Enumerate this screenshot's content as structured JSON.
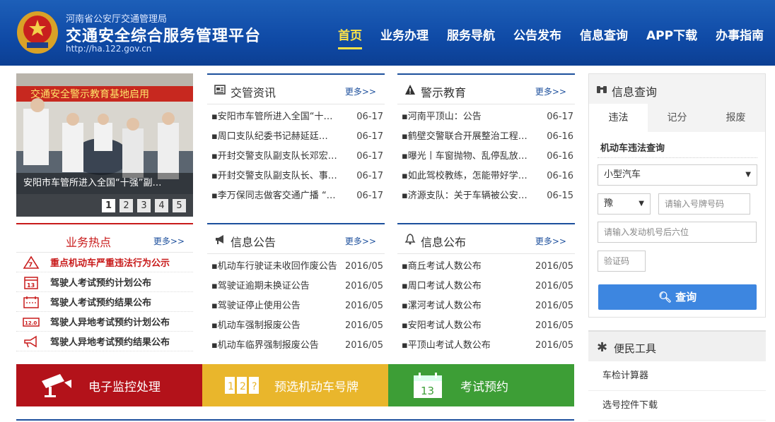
{
  "header": {
    "org": "河南省公安厅交通管理局",
    "title": "交通安全综合服务管理平台",
    "url": "http://ha.122.gov.cn",
    "nav": [
      "首页",
      "业务办理",
      "服务导航",
      "公告发布",
      "信息查询",
      "APP下载",
      "办事指南"
    ]
  },
  "slider": {
    "banner_text": "交通安全警示教育基地启用",
    "caption": "安阳市车管所进入全国“十强”副…",
    "pages": [
      "1",
      "2",
      "3",
      "4",
      "5"
    ],
    "active_page": "1"
  },
  "news": {
    "title": "交管资讯",
    "more": "更多>>",
    "items": [
      {
        "t": "▪安阳市车管所进入全国“十…",
        "d": "06-17"
      },
      {
        "t": "▪周口支队纪委书记赫延廷…",
        "d": "06-17"
      },
      {
        "t": "▪开封交警支队副支队长邓宏…",
        "d": "06-17"
      },
      {
        "t": "▪开封交警支队副支队长、事…",
        "d": "06-17"
      },
      {
        "t": "▪李万保同志做客交通广播 “…",
        "d": "06-17"
      }
    ]
  },
  "warning": {
    "title": "警示教育",
    "more": "更多>>",
    "items": [
      {
        "t": "▪河南平顶山：公告",
        "d": "06-17"
      },
      {
        "t": "▪鹤壁交警联合开展整治工程…",
        "d": "06-16"
      },
      {
        "t": "▪曝光丨车窗抛物、乱停乱放…",
        "d": "06-16"
      },
      {
        "t": "▪如此驾校教练，怎能带好学…",
        "d": "06-16"
      },
      {
        "t": "▪济源支队：关于车辆被公安…",
        "d": "06-15"
      }
    ]
  },
  "hot": {
    "title": "业务热点",
    "more": "更多>>",
    "items": [
      "重点机动车严重违法行为公示",
      "驾驶人考试预约计划公布",
      "驾驶人考试预约结果公布",
      "驾驶人异地考试预约计划公布",
      "驾驶人异地考试预约结果公布"
    ]
  },
  "notice": {
    "title": "信息公告",
    "more": "更多>>",
    "items": [
      {
        "t": "▪机动车行驶证未收回作废公告",
        "d": "2016/05"
      },
      {
        "t": "▪驾驶证逾期未换证公告",
        "d": "2016/05"
      },
      {
        "t": "▪驾驶证停止使用公告",
        "d": "2016/05"
      },
      {
        "t": "▪机动车强制报废公告",
        "d": "2016/05"
      },
      {
        "t": "▪机动车临界强制报废公告",
        "d": "2016/05"
      }
    ]
  },
  "publish": {
    "title": "信息公布",
    "more": "更多>>",
    "items": [
      {
        "t": "▪商丘考试人数公布",
        "d": "2016/05"
      },
      {
        "t": "▪周口考试人数公布",
        "d": "2016/05"
      },
      {
        "t": "▪漯河考试人数公布",
        "d": "2016/05"
      },
      {
        "t": "▪安阳考试人数公布",
        "d": "2016/05"
      },
      {
        "t": "▪平顶山考试人数公布",
        "d": "2016/05"
      }
    ]
  },
  "bars": [
    {
      "label": "电子监控处理",
      "icon": "camera-icon"
    },
    {
      "label": "预选机动车号牌",
      "icon": "plate-icon"
    },
    {
      "label": "考试预约",
      "icon": "calendar-icon"
    }
  ],
  "query": {
    "title": "信息查询",
    "tabs": [
      "违法",
      "记分",
      "报废"
    ],
    "active_tab": "违法",
    "subtitle": "机动车违法查询",
    "vehicle_type": "小型汽车",
    "province": "豫",
    "plate_placeholder": "请输入号牌号码",
    "engine_placeholder": "请输入发动机号后六位",
    "captcha_placeholder": "验证码",
    "submit": "查询"
  },
  "tools": {
    "title": "便民工具",
    "items": [
      "车检计算器",
      "选号控件下载"
    ]
  },
  "colors": {
    "header_blue": "#0f4aa6",
    "nav_active": "#ffe347",
    "hot_red": "#c81a1a",
    "bar_red": "#b3121a",
    "bar_yellow": "#e9b62c",
    "bar_green": "#3d9e36",
    "query_button": "#3d86e0"
  }
}
